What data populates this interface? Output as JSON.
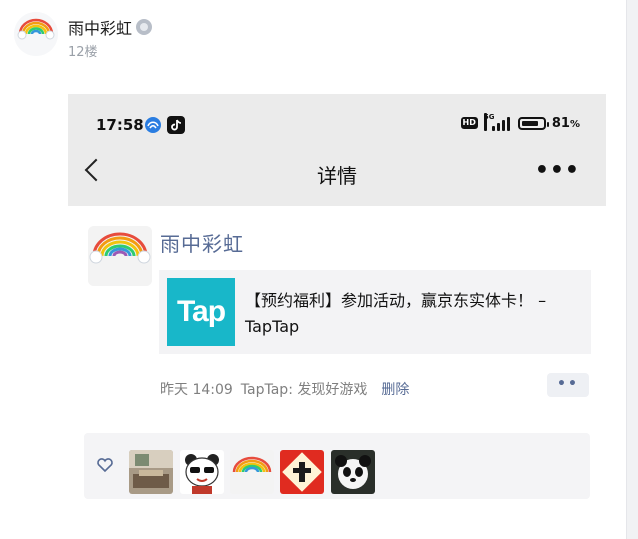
{
  "post": {
    "author": "雨中彩虹",
    "floor": "12楼"
  },
  "screenshot": {
    "status_bar": {
      "time": "17:58",
      "hd": "HD",
      "network": "5G",
      "battery": "81",
      "battery_unit": "%",
      "battery_level": 0.81
    },
    "nav": {
      "title": "详情",
      "more": "•••"
    },
    "moment": {
      "author": "雨中彩虹",
      "link_logo_text": "Tap",
      "link_title": "【预约福利】参加活动，赢京东实体卡！ – TapTap",
      "time": "昨天 14:09",
      "source": "TapTap: 发现好游戏",
      "delete": "删除",
      "action": "••"
    }
  },
  "colors": {
    "accent_link": "#576b95",
    "tap_brand": "#18b7c9",
    "gray_bar": "#ebebeb"
  },
  "icons": [
    "avatar-rainbow",
    "verified-icon",
    "wechat-icon",
    "tiktok-icon",
    "signal-icon",
    "battery-icon",
    "back-chevron-icon",
    "more-icon",
    "heart-icon"
  ]
}
